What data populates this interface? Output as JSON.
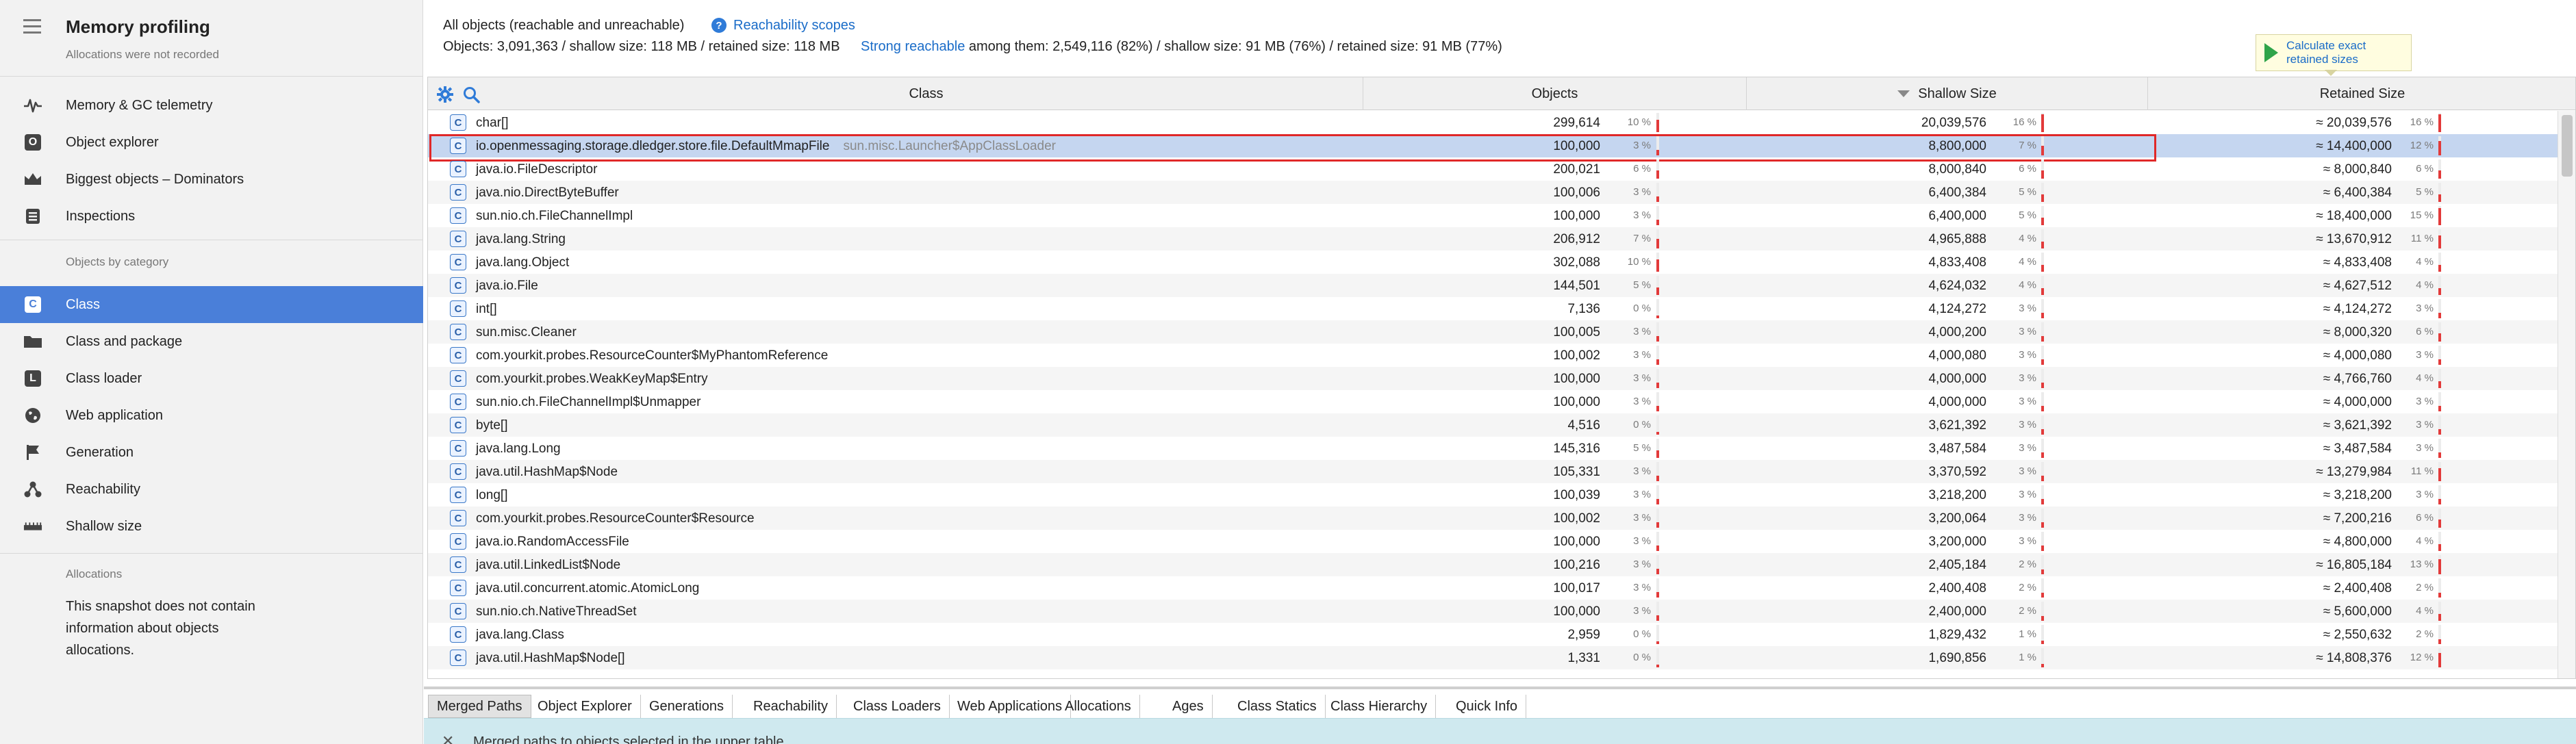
{
  "sidebar": {
    "title": "Memory profiling",
    "subtitle": "Allocations were not recorded",
    "top_items": [
      {
        "label": "Memory & GC telemetry",
        "icon": "telemetry-icon"
      },
      {
        "label": "Object explorer",
        "icon": "object-explorer-icon"
      },
      {
        "label": "Biggest objects – Dominators",
        "icon": "crown-icon"
      },
      {
        "label": "Inspections",
        "icon": "gear-icon"
      }
    ],
    "category_header": "Objects by category",
    "category_items": [
      {
        "label": "Class",
        "icon": "class-icon",
        "active": true
      },
      {
        "label": "Class and package",
        "icon": "folder-icon"
      },
      {
        "label": "Class loader",
        "icon": "class-loader-icon"
      },
      {
        "label": "Web application",
        "icon": "globe-icon"
      },
      {
        "label": "Generation",
        "icon": "flag-icon"
      },
      {
        "label": "Reachability",
        "icon": "reachability-icon"
      },
      {
        "label": "Shallow size",
        "icon": "ruler-icon"
      }
    ],
    "allocations_header": "Allocations",
    "allocations_note": "This snapshot does not contain information about objects allocations."
  },
  "summary": {
    "line1": "All objects (reachable and unreachable)",
    "reachability_link": "Reachability scopes",
    "line2": "Objects: 3,091,363 / shallow size: 118 MB / retained size: 118 MB",
    "strong_link": "Strong reachable",
    "strong_rest": " among them: 2,549,116 (82%) / shallow size: 91 MB (76%) / retained size: 91 MB (77%)",
    "calc_button": "Calculate exact retained sizes"
  },
  "table": {
    "columns": {
      "class": "Class",
      "objects": "Objects",
      "shallow": "Shallow Size",
      "retained": "Retained Size"
    },
    "sort_column": "shallow",
    "rows": [
      {
        "name": "char[]",
        "loader": "",
        "objects": "299,614",
        "objects_pct": "10 %",
        "shallow": "20,039,576",
        "shallow_pct": "16 %",
        "retained": "≈ 20,039,576",
        "retained_pct": "16 %"
      },
      {
        "name": "io.openmessaging.storage.dledger.store.file.DefaultMmapFile",
        "loader": "sun.misc.Launcher$AppClassLoader",
        "objects": "100,000",
        "objects_pct": "3 %",
        "shallow": "8,800,000",
        "shallow_pct": "7 %",
        "retained": "≈ 14,400,000",
        "retained_pct": "12 %",
        "selected": true
      },
      {
        "name": "java.io.FileDescriptor",
        "loader": "",
        "objects": "200,021",
        "objects_pct": "6 %",
        "shallow": "8,000,840",
        "shallow_pct": "6 %",
        "retained": "≈ 8,000,840",
        "retained_pct": "6 %"
      },
      {
        "name": "java.nio.DirectByteBuffer",
        "loader": "",
        "objects": "100,006",
        "objects_pct": "3 %",
        "shallow": "6,400,384",
        "shallow_pct": "5 %",
        "retained": "≈ 6,400,384",
        "retained_pct": "5 %"
      },
      {
        "name": "sun.nio.ch.FileChannelImpl",
        "loader": "",
        "objects": "100,000",
        "objects_pct": "3 %",
        "shallow": "6,400,000",
        "shallow_pct": "5 %",
        "retained": "≈ 18,400,000",
        "retained_pct": "15 %"
      },
      {
        "name": "java.lang.String",
        "loader": "",
        "objects": "206,912",
        "objects_pct": "7 %",
        "shallow": "4,965,888",
        "shallow_pct": "4 %",
        "retained": "≈ 13,670,912",
        "retained_pct": "11 %"
      },
      {
        "name": "java.lang.Object",
        "loader": "",
        "objects": "302,088",
        "objects_pct": "10 %",
        "shallow": "4,833,408",
        "shallow_pct": "4 %",
        "retained": "≈ 4,833,408",
        "retained_pct": "4 %"
      },
      {
        "name": "java.io.File",
        "loader": "",
        "objects": "144,501",
        "objects_pct": "5 %",
        "shallow": "4,624,032",
        "shallow_pct": "4 %",
        "retained": "≈ 4,627,512",
        "retained_pct": "4 %"
      },
      {
        "name": "int[]",
        "loader": "",
        "objects": "7,136",
        "objects_pct": "0 %",
        "shallow": "4,124,272",
        "shallow_pct": "3 %",
        "retained": "≈ 4,124,272",
        "retained_pct": "3 %"
      },
      {
        "name": "sun.misc.Cleaner",
        "loader": "",
        "objects": "100,005",
        "objects_pct": "3 %",
        "shallow": "4,000,200",
        "shallow_pct": "3 %",
        "retained": "≈ 8,000,320",
        "retained_pct": "6 %"
      },
      {
        "name": "com.yourkit.probes.ResourceCounter$MyPhantomReference",
        "loader": "",
        "objects": "100,002",
        "objects_pct": "3 %",
        "shallow": "4,000,080",
        "shallow_pct": "3 %",
        "retained": "≈ 4,000,080",
        "retained_pct": "3 %"
      },
      {
        "name": "com.yourkit.probes.WeakKeyMap$Entry",
        "loader": "",
        "objects": "100,000",
        "objects_pct": "3 %",
        "shallow": "4,000,000",
        "shallow_pct": "3 %",
        "retained": "≈ 4,766,760",
        "retained_pct": "4 %"
      },
      {
        "name": "sun.nio.ch.FileChannelImpl$Unmapper",
        "loader": "",
        "objects": "100,000",
        "objects_pct": "3 %",
        "shallow": "4,000,000",
        "shallow_pct": "3 %",
        "retained": "≈ 4,000,000",
        "retained_pct": "3 %"
      },
      {
        "name": "byte[]",
        "loader": "",
        "objects": "4,516",
        "objects_pct": "0 %",
        "shallow": "3,621,392",
        "shallow_pct": "3 %",
        "retained": "≈ 3,621,392",
        "retained_pct": "3 %"
      },
      {
        "name": "java.lang.Long",
        "loader": "",
        "objects": "145,316",
        "objects_pct": "5 %",
        "shallow": "3,487,584",
        "shallow_pct": "3 %",
        "retained": "≈ 3,487,584",
        "retained_pct": "3 %"
      },
      {
        "name": "java.util.HashMap$Node",
        "loader": "",
        "objects": "105,331",
        "objects_pct": "3 %",
        "shallow": "3,370,592",
        "shallow_pct": "3 %",
        "retained": "≈ 13,279,984",
        "retained_pct": "11 %"
      },
      {
        "name": "long[]",
        "loader": "",
        "objects": "100,039",
        "objects_pct": "3 %",
        "shallow": "3,218,200",
        "shallow_pct": "3 %",
        "retained": "≈ 3,218,200",
        "retained_pct": "3 %"
      },
      {
        "name": "com.yourkit.probes.ResourceCounter$Resource",
        "loader": "",
        "objects": "100,002",
        "objects_pct": "3 %",
        "shallow": "3,200,064",
        "shallow_pct": "3 %",
        "retained": "≈ 7,200,216",
        "retained_pct": "6 %"
      },
      {
        "name": "java.io.RandomAccessFile",
        "loader": "",
        "objects": "100,000",
        "objects_pct": "3 %",
        "shallow": "3,200,000",
        "shallow_pct": "3 %",
        "retained": "≈ 4,800,000",
        "retained_pct": "4 %"
      },
      {
        "name": "java.util.LinkedList$Node",
        "loader": "",
        "objects": "100,216",
        "objects_pct": "3 %",
        "shallow": "2,405,184",
        "shallow_pct": "2 %",
        "retained": "≈ 16,805,184",
        "retained_pct": "13 %"
      },
      {
        "name": "java.util.concurrent.atomic.AtomicLong",
        "loader": "",
        "objects": "100,017",
        "objects_pct": "3 %",
        "shallow": "2,400,408",
        "shallow_pct": "2 %",
        "retained": "≈ 2,400,408",
        "retained_pct": "2 %"
      },
      {
        "name": "sun.nio.ch.NativeThreadSet",
        "loader": "",
        "objects": "100,000",
        "objects_pct": "3 %",
        "shallow": "2,400,000",
        "shallow_pct": "2 %",
        "retained": "≈ 5,600,000",
        "retained_pct": "4 %"
      },
      {
        "name": "java.lang.Class",
        "loader": "",
        "objects": "2,959",
        "objects_pct": "0 %",
        "shallow": "1,829,432",
        "shallow_pct": "1 %",
        "retained": "≈ 2,550,632",
        "retained_pct": "2 %"
      },
      {
        "name": "java.util.HashMap$Node[]",
        "loader": "",
        "objects": "1,331",
        "objects_pct": "0 %",
        "shallow": "1,690,856",
        "shallow_pct": "1 %",
        "retained": "≈ 14,808,376",
        "retained_pct": "12 %"
      }
    ]
  },
  "tabs": [
    {
      "label": "Merged Paths",
      "active": true
    },
    {
      "label": "Object Explorer"
    },
    {
      "label": "Generations"
    },
    {
      "label": "Reachability"
    },
    {
      "label": "Class Loaders"
    },
    {
      "label": "Web Applications"
    },
    {
      "label": "Allocations"
    },
    {
      "label": "Ages"
    },
    {
      "label": "Class Statics"
    },
    {
      "label": "Class Hierarchy"
    },
    {
      "label": "Quick Info"
    }
  ],
  "bottom_panel": {
    "text": "Merged paths to objects selected in the upper table"
  },
  "colors": {
    "accent": "#4a7fd9",
    "selection": "#c5d6f0",
    "selection_border": "#e02828",
    "bar": "#e23a3a",
    "link": "#1a6cc8"
  }
}
